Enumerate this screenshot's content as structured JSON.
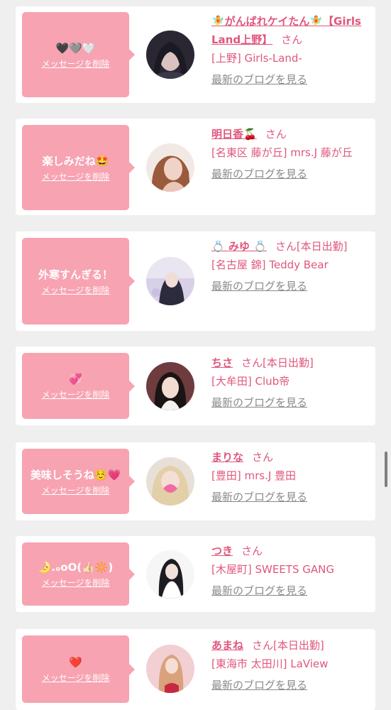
{
  "cards": [
    {
      "message": "🖤🩶🤍",
      "delete_label": "メッセージを削除",
      "name": "🧚がんばれケイたん🧚【Girls Land上野】",
      "san": "さん",
      "shop": "[上野] Girls-Land-",
      "blog_label": "最新のブログを見る"
    },
    {
      "message": "",
      "delete_label": "メッセージを削除",
      "name": "明日香🍒",
      "san": "さん",
      "shop": "[名東区 藤が丘] mrs.J 藤が丘",
      "blog_label": "最新のブログを見る"
    },
    {
      "message": "外寒すんぎる！",
      "delete_label": "メッセージを削除",
      "name": "💍 みゆ 💍",
      "san": "さん[本日出勤]",
      "shop": "[名古屋 錦] Teddy Bear",
      "blog_label": "最新のブログを見る"
    },
    {
      "message": "💞",
      "delete_label": "メッセージを削除",
      "name": "ちさ",
      "san": "さん[本日出勤]",
      "shop": "[大牟田] Club帝",
      "blog_label": "最新のブログを見る"
    },
    {
      "message": "",
      "delete_label": "メッセージを削除",
      "name": "まりな",
      "san": "さん",
      "shop": "[豊田] mrs.J 豊田",
      "blog_label": "最新のブログを見る"
    },
    {
      "message": "🌛.ₒoO(👍🏻🔆)",
      "delete_label": "メッセージを削除",
      "name": "つき",
      "san": "さん",
      "shop": "[木屋町] SWEETS GANG",
      "blog_label": "最新のブログを見る"
    },
    {
      "message": "❤️",
      "delete_label": "メッセージを削除",
      "name": "あまね",
      "san": "さん[本日出勤]",
      "shop": "[東海市 太田川] LaView",
      "blog_label": "最新のブログを見る"
    }
  ],
  "emoji_text": {
    "card2": "楽しみだね🤩",
    "card5": "美味しそうね☺️💗"
  }
}
